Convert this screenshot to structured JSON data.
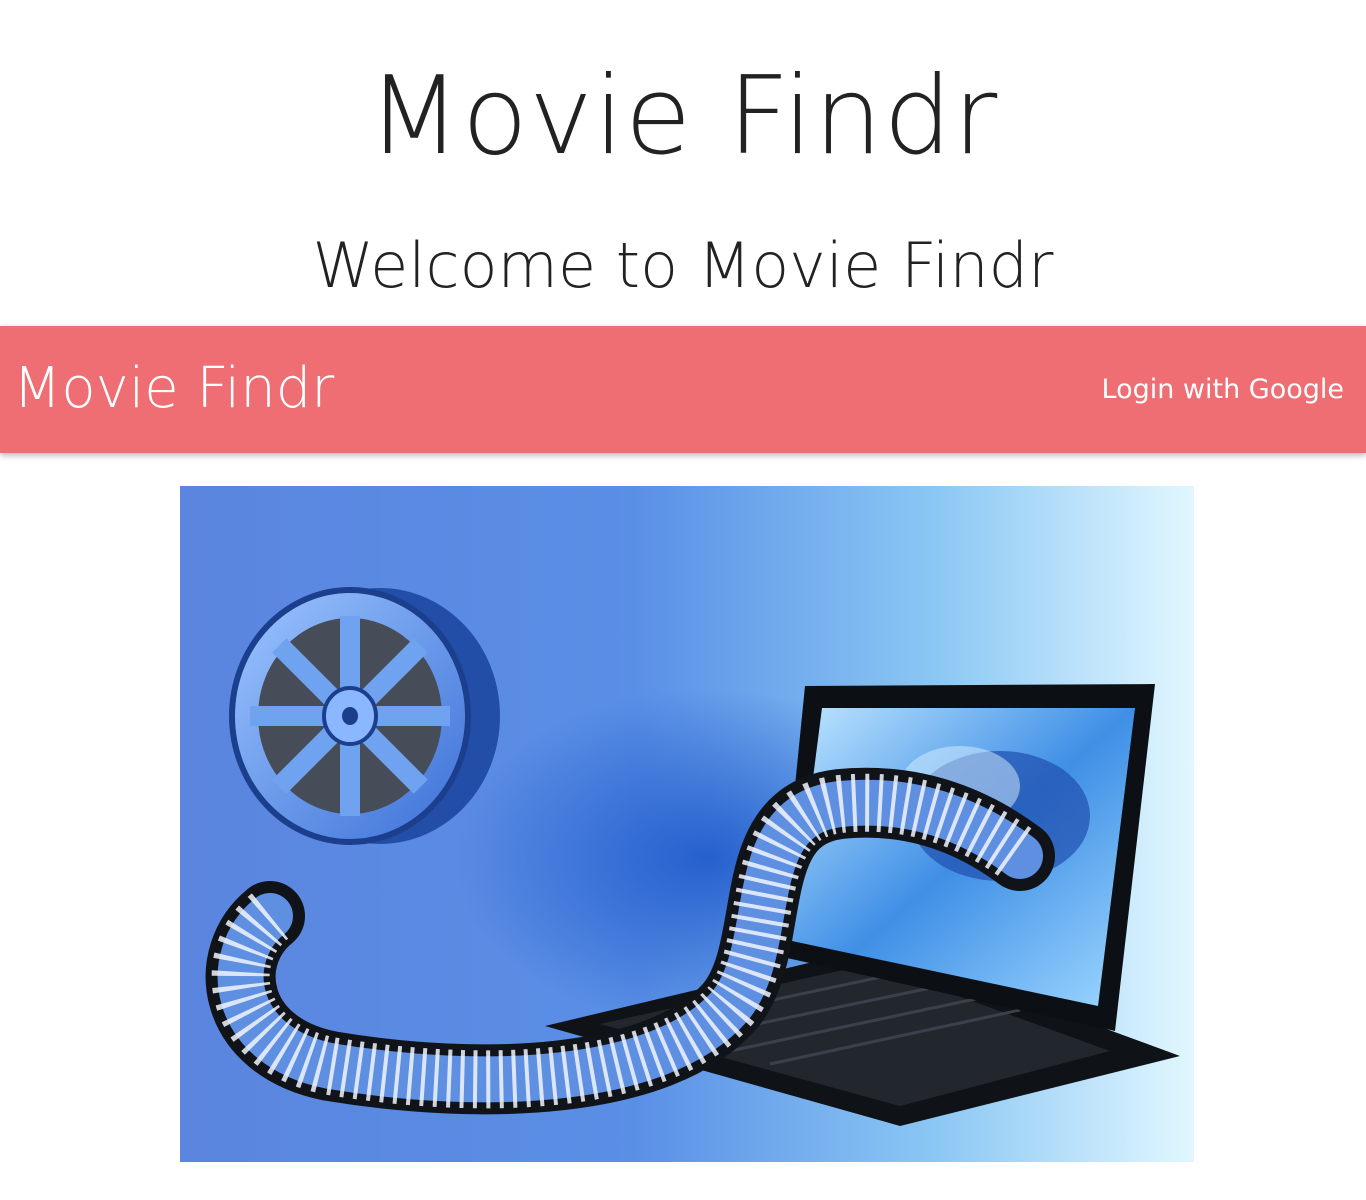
{
  "header": {
    "title": "Movie Findr",
    "welcome": "Welcome to Movie Findr"
  },
  "navbar": {
    "brand": "Movie Findr",
    "login_label": "Login with Google",
    "color": "#ee6e73"
  },
  "hero": {
    "image_alt": "film-reel-and-laptop-illustration",
    "colors": {
      "background_left": "#5a86e0",
      "background_right": "#dff6ff",
      "laptop": "#111418",
      "reel": "#6fa3f0"
    }
  }
}
